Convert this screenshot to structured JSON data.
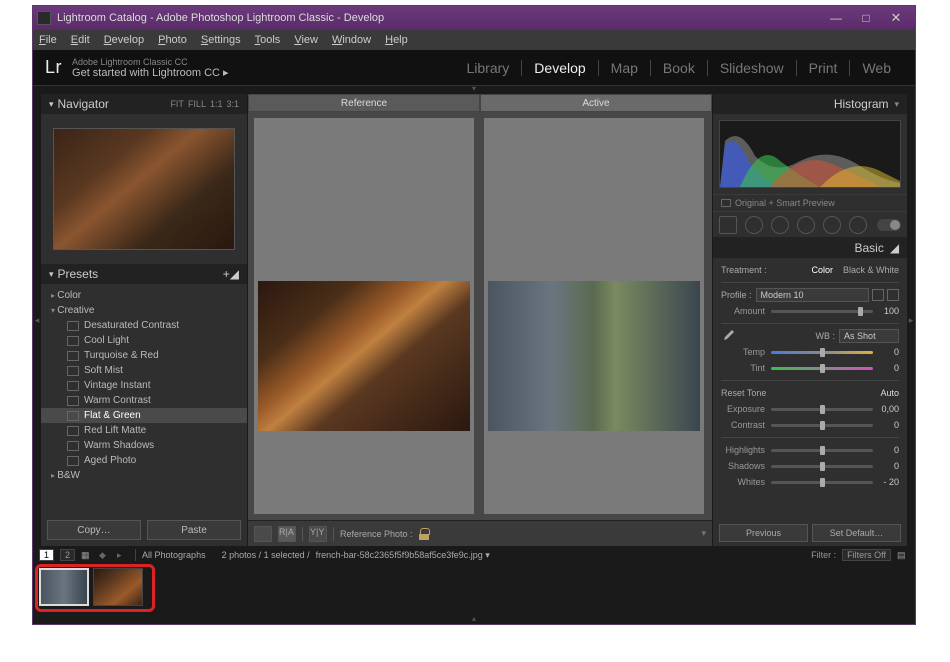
{
  "window": {
    "title": "Lightroom Catalog - Adobe Photoshop Lightroom Classic - Develop"
  },
  "menu": [
    "File",
    "Edit",
    "Develop",
    "Photo",
    "Settings",
    "Tools",
    "View",
    "Window",
    "Help"
  ],
  "logo": "Lr",
  "tagline_top": "Adobe Lightroom Classic CC",
  "tagline_sub": "Get started with Lightroom CC  ▸",
  "modules": [
    {
      "label": "Library",
      "active": false
    },
    {
      "label": "Develop",
      "active": true
    },
    {
      "label": "Map",
      "active": false
    },
    {
      "label": "Book",
      "active": false
    },
    {
      "label": "Slideshow",
      "active": false
    },
    {
      "label": "Print",
      "active": false
    },
    {
      "label": "Web",
      "active": false
    }
  ],
  "navigator": {
    "title": "Navigator",
    "zooms": [
      "FIT",
      "FILL",
      "1:1",
      "3:1"
    ]
  },
  "presets": {
    "title": "Presets",
    "folders": [
      {
        "name": "Color",
        "open": false,
        "items": []
      },
      {
        "name": "Creative",
        "open": true,
        "items": [
          "Desaturated Contrast",
          "Cool Light",
          "Turquoise & Red",
          "Soft Mist",
          "Vintage Instant",
          "Warm Contrast",
          "Flat & Green",
          "Red Lift Matte",
          "Warm Shadows",
          "Aged Photo"
        ],
        "selected": "Flat & Green"
      },
      {
        "name": "B&W",
        "open": false,
        "items": []
      }
    ],
    "copy_btn": "Copy…",
    "paste_btn": "Paste"
  },
  "histogram": {
    "title": "Histogram",
    "status": "Original + Smart Preview"
  },
  "basic": {
    "title": "Basic",
    "treatment_label": "Treatment :",
    "color": "Color",
    "bw": "Black & White",
    "profile_label": "Profile :",
    "profile": "Modern 10",
    "amount_label": "Amount",
    "amount": "100",
    "wb_label": "WB :",
    "wb": "As Shot",
    "temp_label": "Temp",
    "temp": "0",
    "tint_label": "Tint",
    "tint": "0",
    "reset_tone": "Reset Tone",
    "auto": "Auto",
    "exposure_label": "Exposure",
    "exposure": "0,00",
    "contrast_label": "Contrast",
    "contrast": "0",
    "highlights_label": "Highlights",
    "highlights": "0",
    "shadows_label": "Shadows",
    "shadows": "0",
    "whites_label": "Whites",
    "whites": "- 20",
    "previous": "Previous",
    "set_default": "Set Default…"
  },
  "center": {
    "tab_reference": "Reference",
    "tab_active": "Active",
    "ref_label": "Reference Photo :"
  },
  "filmstrip": {
    "source": "All Photographs",
    "counts": "2 photos / 1 selected  /",
    "filename": "french-bar-58c2365f5f9b58af5ce3fe9c.jpg ▾",
    "filter_label": "Filter :",
    "filter": "Filters Off"
  }
}
